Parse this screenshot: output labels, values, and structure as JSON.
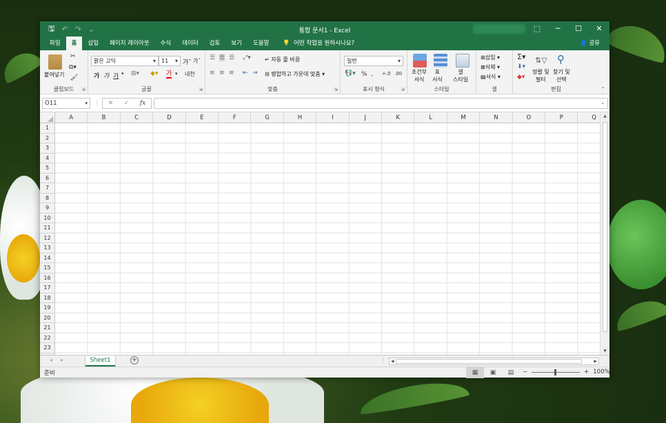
{
  "titlebar": {
    "title": "통합 문서1 - Excel",
    "qat": {
      "save": "🖫",
      "undo": "↶",
      "redo": "↷",
      "customize": "⌄"
    },
    "controls": {
      "ribbon_display": "⬚",
      "minimize": "─",
      "maximize": "☐",
      "close": "✕"
    }
  },
  "tabs": [
    {
      "label": "파일"
    },
    {
      "label": "홈"
    },
    {
      "label": "삽입"
    },
    {
      "label": "페이지 레이아웃"
    },
    {
      "label": "수식"
    },
    {
      "label": "데이터"
    },
    {
      "label": "검토"
    },
    {
      "label": "보기"
    },
    {
      "label": "도움말"
    }
  ],
  "tellme": {
    "icon": "💡",
    "text": "어떤 작업을 원하시나요?"
  },
  "share": {
    "label": "공유",
    "icon": "👤"
  },
  "ribbon": {
    "clipboard": {
      "paste": "붙여넣기",
      "label": "클립보드"
    },
    "font": {
      "name": "맑은 고딕",
      "size": "11",
      "grow": "가",
      "shrink": "가",
      "bold": "가",
      "italic": "가",
      "underline": "가",
      "font_color": "가",
      "phonetic": "내천",
      "label": "글꼴"
    },
    "alignment": {
      "wrap": "자동 줄 바꿈",
      "merge": "병합하고 가운데 맞춤",
      "label": "맞춤"
    },
    "number": {
      "format": "일반",
      "percent": "%",
      "comma": ",",
      "inc": "+.0",
      "dec": ".00",
      "label": "표시 형식"
    },
    "styles": {
      "conditional": [
        "조건부",
        "서식"
      ],
      "table": [
        "표",
        "서식"
      ],
      "cell": [
        "셀",
        "스타일"
      ],
      "label": "스타일"
    },
    "cells": {
      "insert": "삽입",
      "delete": "삭제",
      "format": "서식",
      "label": "셀"
    },
    "editing": {
      "sort": [
        "정렬 및",
        "필터"
      ],
      "find": [
        "찾기 및",
        "선택"
      ],
      "label": "편집"
    }
  },
  "formula": {
    "namebox": "O11",
    "cancel": "✕",
    "enter": "✓",
    "fx": "fx",
    "value": ""
  },
  "columns": [
    "A",
    "B",
    "C",
    "D",
    "E",
    "F",
    "G",
    "H",
    "I",
    "J",
    "K",
    "L",
    "M",
    "N",
    "O",
    "P",
    "Q"
  ],
  "rows": [
    "1",
    "2",
    "3",
    "4",
    "5",
    "6",
    "7",
    "8",
    "9",
    "10",
    "11",
    "12",
    "13",
    "14",
    "15",
    "16",
    "17",
    "18",
    "19",
    "20",
    "21",
    "22",
    "23"
  ],
  "sheets": [
    {
      "label": "Sheet1",
      "active": true
    }
  ],
  "add_sheet": "+",
  "status": {
    "ready": "준비",
    "zoom": "100%",
    "zoom_minus": "−",
    "zoom_plus": "+"
  },
  "colors": {
    "accent": "#217346",
    "ribbon_bg": "#f3f3f3"
  }
}
